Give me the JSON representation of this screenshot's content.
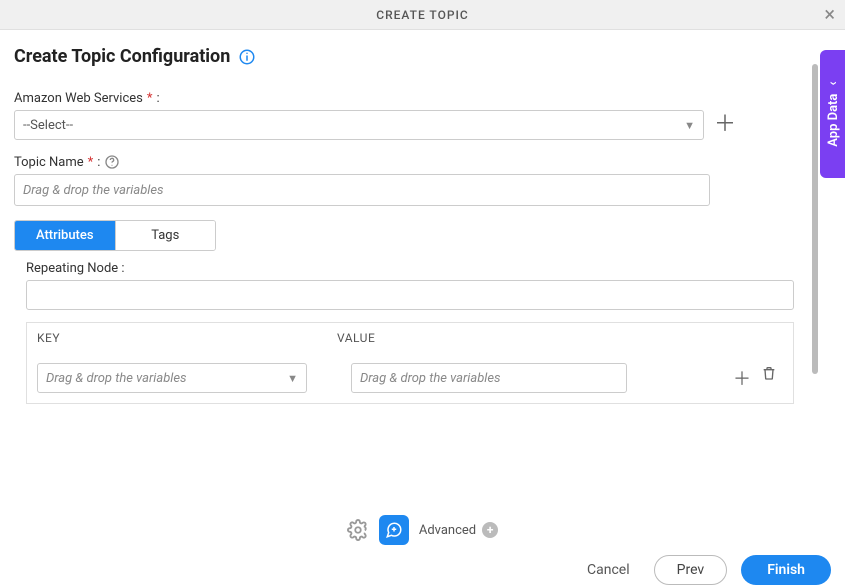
{
  "header": {
    "title": "CREATE TOPIC"
  },
  "page": {
    "title": "Create Topic Configuration"
  },
  "fields": {
    "aws_label": "Amazon Web Services",
    "aws_select_placeholder": "--Select--",
    "topic_label": "Topic Name",
    "topic_placeholder": "Drag & drop the variables"
  },
  "tabs": {
    "attributes": "Attributes",
    "tags": "Tags"
  },
  "attributes": {
    "repeating_label": "Repeating Node :",
    "key_header": "KEY",
    "value_header": "VALUE",
    "row": {
      "key_placeholder": "Drag & drop the variables",
      "value_placeholder": "Drag & drop the variables"
    }
  },
  "side": {
    "label": "App Data"
  },
  "footer": {
    "advanced": "Advanced",
    "cancel": "Cancel",
    "prev": "Prev",
    "finish": "Finish"
  },
  "colors": {
    "primary": "#1e88f0",
    "accent": "#7b3ff2"
  }
}
